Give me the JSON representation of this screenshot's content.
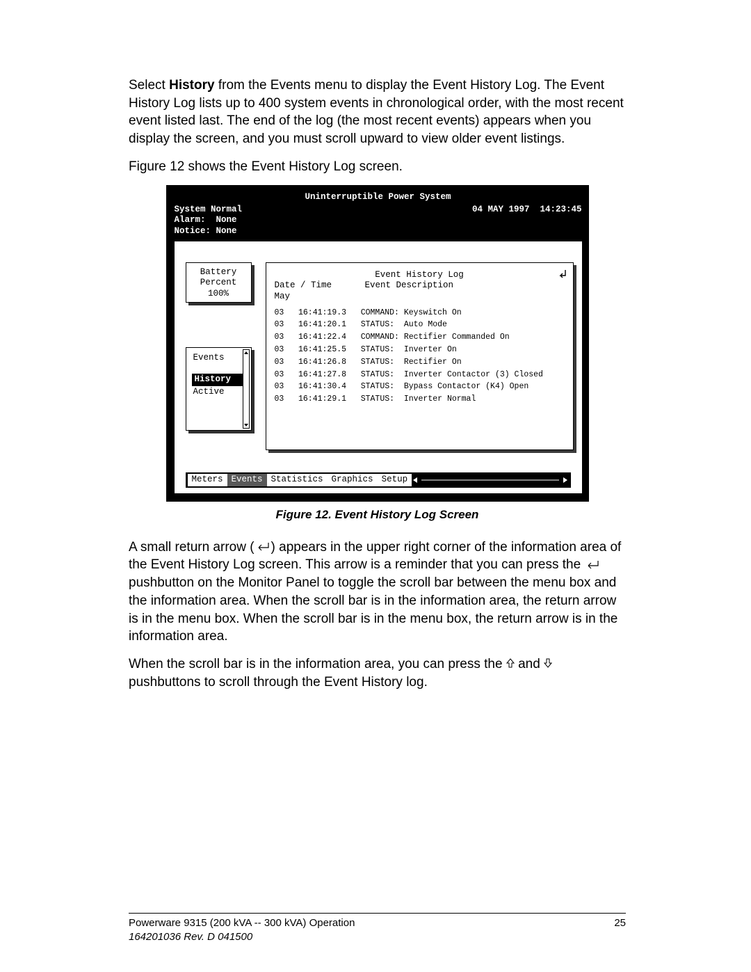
{
  "para1_pre": "Select ",
  "para1_bold": "History",
  "para1_post": " from the Events menu to display the Event History Log.  The Event History Log lists up to 400 system events in chronological order, with the most recent event listed last.  The end of the log (the most recent events) appears when you display the screen, and you must scroll upward to view older event listings.",
  "para2": "Figure 12 shows the Event History Log screen.",
  "ups": {
    "title": "Uninterruptible Power System",
    "status_lines": "System Normal\nAlarm:  None\nNotice: None",
    "datetime": "04 MAY 1997  14:23:45",
    "battery_l1": "Battery",
    "battery_l2": "Percent",
    "battery_l3": "100%",
    "menu_events": "Events",
    "menu_history": "History",
    "menu_active": "Active",
    "log_title": "Event History Log",
    "log_hdr_date": "Date / Time",
    "log_hdr_desc": "Event Description",
    "log_month": "May",
    "events": [
      {
        "day": "03",
        "time": "16:41:19.3",
        "type": "COMMAND:",
        "desc": "Keyswitch On"
      },
      {
        "day": "03",
        "time": "16:41:20.1",
        "type": "STATUS:",
        "desc": "Auto Mode"
      },
      {
        "day": "03",
        "time": "16:41:22.4",
        "type": "COMMAND:",
        "desc": "Rectifier Commanded On"
      },
      {
        "day": "03",
        "time": "16:41:25.5",
        "type": "STATUS:",
        "desc": "Inverter On"
      },
      {
        "day": "03",
        "time": "16:41:26.8",
        "type": "STATUS:",
        "desc": "Rectifier On"
      },
      {
        "day": "03",
        "time": "16:41:27.8",
        "type": "STATUS:",
        "desc": "Inverter Contactor (3) Closed"
      },
      {
        "day": "03",
        "time": "16:41:30.4",
        "type": "STATUS:",
        "desc": "Bypass Contactor (K4) Open"
      },
      {
        "day": "03",
        "time": "16:41:29.1",
        "type": "STATUS:",
        "desc": "Inverter Normal"
      }
    ],
    "tabs": {
      "meters": "Meters",
      "events": "Events",
      "statistics": "Statistics",
      "graphics": "Graphics",
      "setup": "Setup"
    }
  },
  "figcap": "Figure 12.  Event History Log Screen",
  "para3a": "A small return arrow (",
  "para3b": ") appears in the upper right corner of the information area of the Event History Log screen.  This arrow is a reminder that you can press the ",
  "para3c": " pushbutton on the Monitor Panel to toggle the scroll bar between the menu box and the information area.  When the scroll bar is in the information area, the return arrow is in the menu box.  When the scroll bar is in the menu box, the return arrow is in the information area.",
  "para4a": "When the scroll bar is in the information area, you can press the ",
  "para4b": " and ",
  "para4c": " pushbuttons to scroll through the Event History log.",
  "footer_line1": "Powerware 9315 (200 kVA -- 300 kVA) Operation",
  "footer_line2": "164201036  Rev. D  041500",
  "footer_page": "25"
}
